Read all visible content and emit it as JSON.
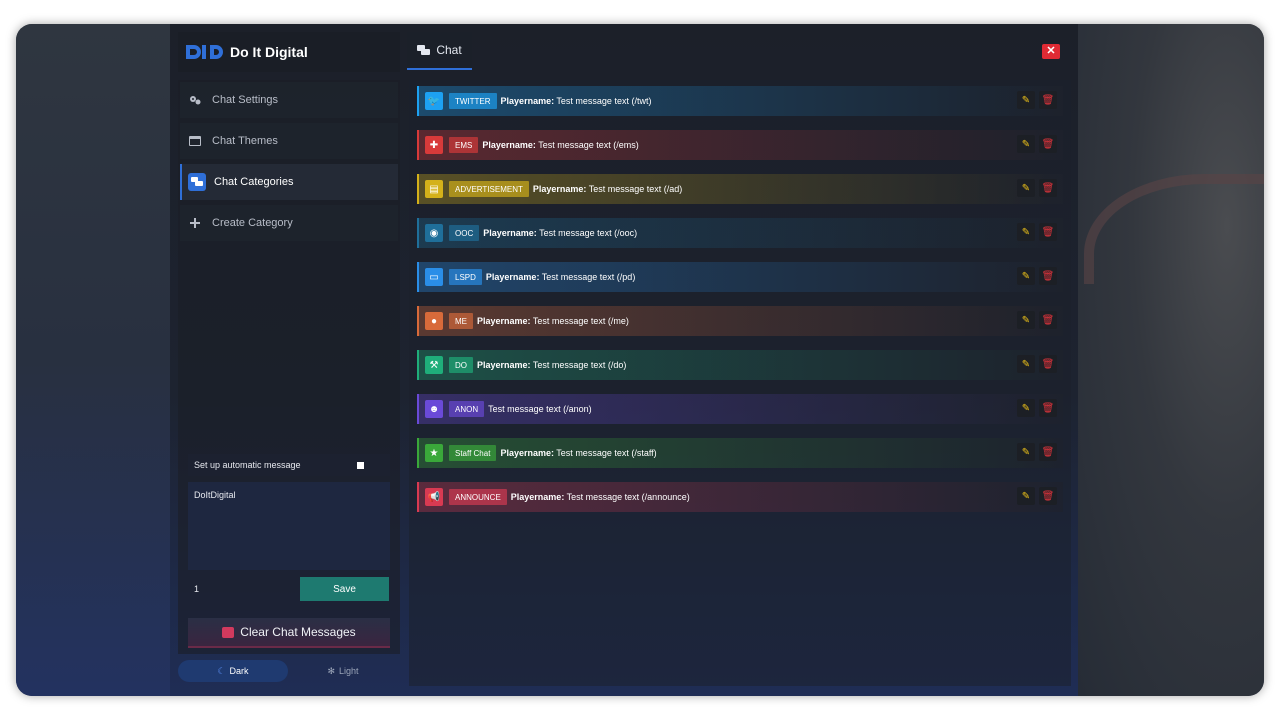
{
  "brand": {
    "name": "Do It Digital"
  },
  "tabs": {
    "chat_label": "Chat"
  },
  "window": {
    "close_label": "✕"
  },
  "sidebar": {
    "items": [
      {
        "label": "Chat Settings",
        "icon": "gears-icon"
      },
      {
        "label": "Chat Themes",
        "icon": "window-icon"
      },
      {
        "label": "Chat Categories",
        "icon": "chat-bubbles-icon"
      },
      {
        "label": "Create Category",
        "icon": "plus-icon"
      }
    ]
  },
  "auto_message": {
    "label": "Set up automatic message",
    "text": "DoItDigital",
    "interval": "1",
    "save_label": "Save"
  },
  "clear": {
    "label": "Clear Chat Messages"
  },
  "theme": {
    "dark_label": "Dark",
    "light_label": "Light"
  },
  "categories": [
    {
      "tag": "TWITTER",
      "name": "Playername:",
      "message": " Test message text (/twt)",
      "color": "#1da1f2"
    },
    {
      "tag": "EMS",
      "name": "Playername:",
      "message": " Test message text (/ems)",
      "color": "#d83a3a"
    },
    {
      "tag": "ADVERTISEMENT",
      "name": "Playername:",
      "message": " Test message text (/ad)",
      "color": "#d4b11a"
    },
    {
      "tag": "OOC",
      "name": "Playername:",
      "message": " Test message text (/ooc)",
      "color": "#1f6f9a"
    },
    {
      "tag": "LSPD",
      "name": "Playername:",
      "message": " Test message text (/pd)",
      "color": "#2a8ee8"
    },
    {
      "tag": "ME",
      "name": "Playername:",
      "message": " Test message text (/me)",
      "color": "#d86a3a"
    },
    {
      "tag": "DO",
      "name": "Playername:",
      "message": " Test message text (/do)",
      "color": "#1fae7a"
    },
    {
      "tag": "ANON",
      "name": "",
      "message": "Test message text (/anon)",
      "color": "#6a4ad8"
    },
    {
      "tag": "Staff Chat",
      "name": "Playername:",
      "message": " Test message text (/staff)",
      "color": "#3aa83a"
    },
    {
      "tag": "ANNOUNCE",
      "name": "Playername:",
      "message": " Test message text (/announce)",
      "color": "#d83a52"
    }
  ]
}
